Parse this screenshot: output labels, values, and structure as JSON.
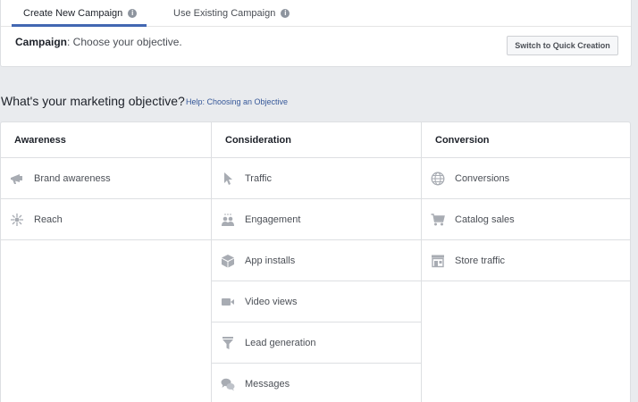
{
  "tabs": {
    "create_label": "Create New Campaign",
    "existing_label": "Use Existing Campaign"
  },
  "campaign": {
    "label": "Campaign",
    "text": ": Choose your objective."
  },
  "quick_button_label": "Switch to Quick Creation",
  "objective_heading": "What's your marketing objective?",
  "help_link": "Help: Choosing an Objective",
  "columns": {
    "awareness": {
      "title": "Awareness",
      "items": [
        {
          "label": "Brand awareness",
          "icon": "megaphone-icon"
        },
        {
          "label": "Reach",
          "icon": "reach-icon"
        }
      ]
    },
    "consideration": {
      "title": "Consideration",
      "items": [
        {
          "label": "Traffic",
          "icon": "cursor-icon"
        },
        {
          "label": "Engagement",
          "icon": "people-icon"
        },
        {
          "label": "App installs",
          "icon": "box-icon"
        },
        {
          "label": "Video views",
          "icon": "video-camera-icon"
        },
        {
          "label": "Lead generation",
          "icon": "funnel-icon"
        },
        {
          "label": "Messages",
          "icon": "chat-bubbles-icon"
        }
      ]
    },
    "conversion": {
      "title": "Conversion",
      "items": [
        {
          "label": "Conversions",
          "icon": "globe-icon"
        },
        {
          "label": "Catalog sales",
          "icon": "shopping-cart-icon"
        },
        {
          "label": "Store traffic",
          "icon": "store-icon"
        }
      ]
    }
  },
  "colors": {
    "accent": "#4267b2",
    "link": "#365899",
    "icon": "#a8acb3",
    "background": "#e9ebee"
  }
}
